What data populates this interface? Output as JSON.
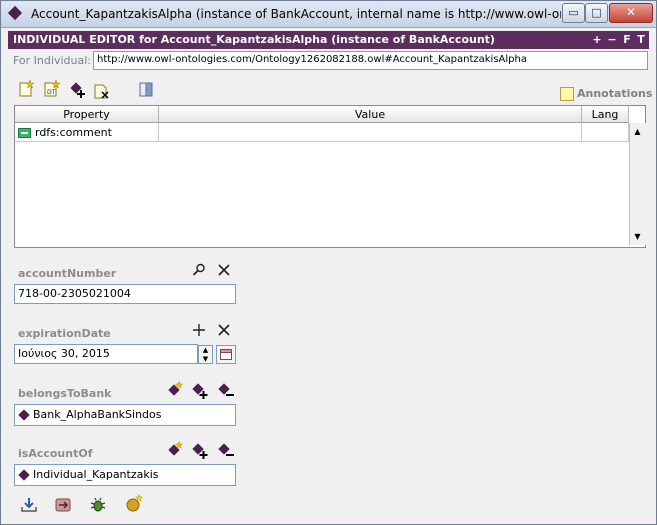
{
  "window": {
    "title": "Account_KapantzakisAlpha   (instance of BankAccount, internal name is http://www.owl-ontologi...",
    "minimize_glyph": "▭",
    "maximize_glyph": "□",
    "close_glyph": "✕"
  },
  "editor": {
    "title": "INDIVIDUAL EDITOR for Account_KapantzakisAlpha   (instance of BankAccount)",
    "buttons": [
      "+",
      "−",
      "F",
      "T"
    ]
  },
  "for_individual": {
    "label": "For Individual:",
    "value": "http://www.owl-ontologies.com/Ontology1262082188.owl#Account_KapantzakisAlpha"
  },
  "annotations_label": "Annotations",
  "table": {
    "columns": [
      "Property",
      "Value",
      "Lang"
    ],
    "rows": [
      {
        "property": "rdfs:comment",
        "value": "",
        "lang": ""
      }
    ]
  },
  "properties": {
    "accountNumber": {
      "label": "accountNumber",
      "value": "718-00-2305021004"
    },
    "expirationDate": {
      "label": "expirationDate",
      "value": "Ιούνιος 30, 2015"
    },
    "belongsToBank": {
      "label": "belongsToBank",
      "value": "Bank_AlphaBankSindos"
    },
    "isAccountOf": {
      "label": "isAccountOf",
      "value": "Individual_Kapantzakis"
    }
  },
  "colors": {
    "accent": "#5c2d5e",
    "instance_diamond": "#4b1f4f",
    "label_gray": "#8c8c8c"
  }
}
